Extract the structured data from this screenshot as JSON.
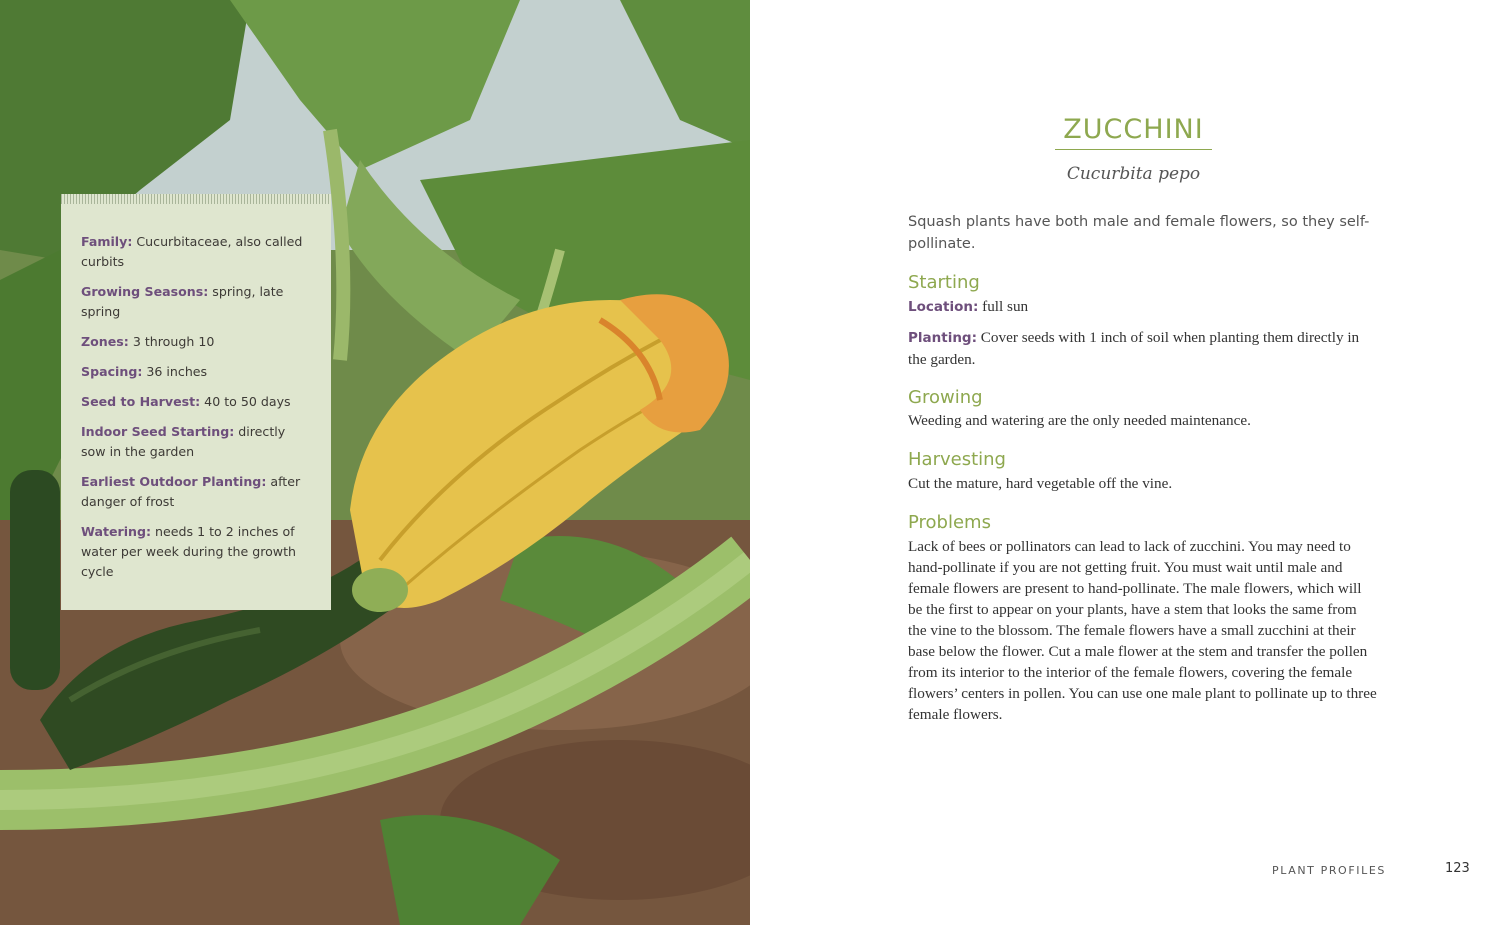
{
  "info_box": {
    "rows": [
      {
        "key": "Family:",
        "value": " Cucurbitaceae, also called curbits"
      },
      {
        "key": "Growing Seasons:",
        "value": " spring, late spring"
      },
      {
        "key": "Zones:",
        "value": " 3 through 10"
      },
      {
        "key": "Spacing:",
        "value": " 36 inches"
      },
      {
        "key": "Seed to Harvest:",
        "value": " 40 to 50 days"
      },
      {
        "key": "Indoor Seed Starting:",
        "value": " directly sow in the garden"
      },
      {
        "key": "Earliest Outdoor Planting:",
        "value": " after danger of frost"
      },
      {
        "key": "Watering:",
        "value": " needs 1 to 2 inches of water per week during the growth cycle"
      }
    ]
  },
  "profile": {
    "title": "ZUCCHINI",
    "latin_name": "Cucurbita pepo",
    "intro": "Squash plants have both male and female flowers, so they self-pollinate.",
    "starting": {
      "heading": "Starting",
      "location_key": "Location:",
      "location_value": " full sun",
      "planting_key": "Planting:",
      "planting_value": " Cover seeds with 1 inch of soil when planting them directly in the garden."
    },
    "growing": {
      "heading": "Growing",
      "text": "Weeding and watering are the only needed maintenance."
    },
    "harvesting": {
      "heading": "Harvesting",
      "text": "Cut the mature, hard vegetable off the vine."
    },
    "problems": {
      "heading": "Problems",
      "text": "Lack of bees or pollinators can lead to lack of zucchini. You may need to hand-pollinate if you are not getting fruit. You must wait until male and female flowers are present to hand-pollinate. The male flowers, which will be the first to appear on your plants, have a stem that looks the same from the vine to the blossom. The female flowers have a small zucchini at their base below the flower. Cut a male flower at the stem and transfer the pollen from its interior to the interior of the female flowers, covering the female flowers’ centers in pollen. You can use one male plant to pollinate up to three female flowers."
    }
  },
  "footer": {
    "section": "PLANT PROFILES",
    "page": "123"
  },
  "colors": {
    "accent_green": "#8ea84f",
    "key_purple": "#6e4f7c",
    "info_box_bg": "#dfe6cf"
  }
}
